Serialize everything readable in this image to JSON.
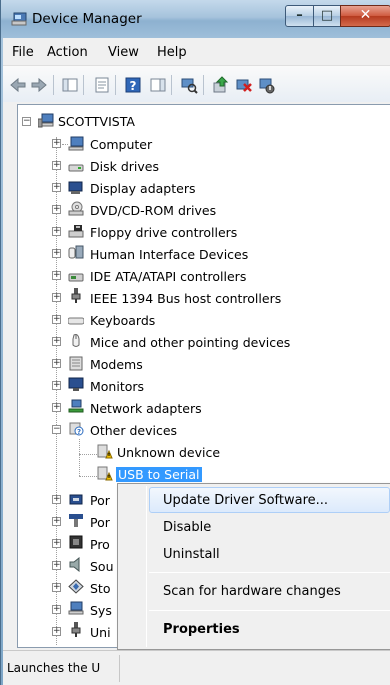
{
  "window": {
    "title": "Device Manager"
  },
  "menubar": [
    "File",
    "Action",
    "View",
    "Help"
  ],
  "tree": {
    "root": "SCOTTVISTA",
    "categories": [
      "Computer",
      "Disk drives",
      "Display adapters",
      "DVD/CD-ROM drives",
      "Floppy drive controllers",
      "Human Interface Devices",
      "IDE ATA/ATAPI controllers",
      "IEEE 1394 Bus host controllers",
      "Keyboards",
      "Mice and other pointing devices",
      "Modems",
      "Monitors",
      "Network adapters",
      "Other devices"
    ],
    "other_devices": [
      "Unknown device",
      "USB to Serial"
    ],
    "truncated": [
      "Por",
      "Por",
      "Pro",
      "Sou",
      "Sto",
      "Sys",
      "Uni"
    ]
  },
  "context_menu": {
    "items": [
      "Update Driver Software...",
      "Disable",
      "Uninstall",
      "Scan for hardware changes",
      "Properties"
    ]
  },
  "status": {
    "text": "Launches the U"
  }
}
